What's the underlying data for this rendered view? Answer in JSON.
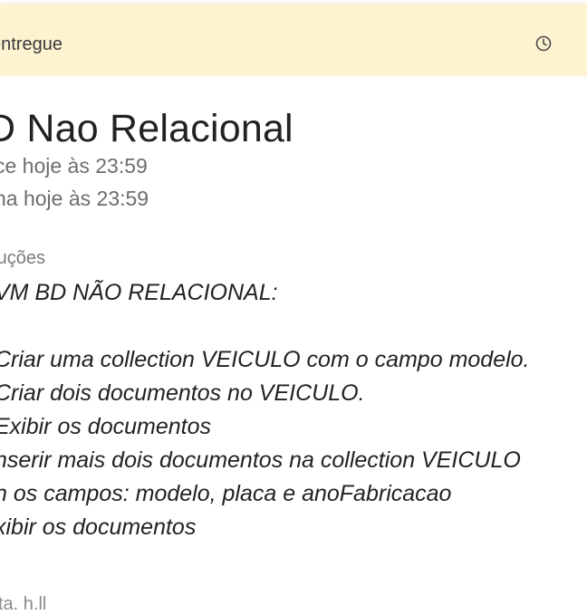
{
  "banner": {
    "status_text": "entregue",
    "icon": "clock-icon"
  },
  "assignment": {
    "title": "D Nao Relacional",
    "due_lines": [
      "ce hoje às 23:59",
      "ha hoje às 23:59"
    ]
  },
  "instructions": {
    "label": "ruções",
    "lines": [
      "VM BD NÃO RELACIONAL:",
      "Criar uma collection VEICULO com o campo modelo.",
      "Criar dois documentos no VEICULO.",
      "Exibir os documentos",
      "nserir mais dois documentos na collection VEICULO",
      "n os campos: modelo, placa e anoFabricacao",
      "xibir os documentos"
    ]
  },
  "footer": {
    "partial_text": "ta. h.ll"
  }
}
